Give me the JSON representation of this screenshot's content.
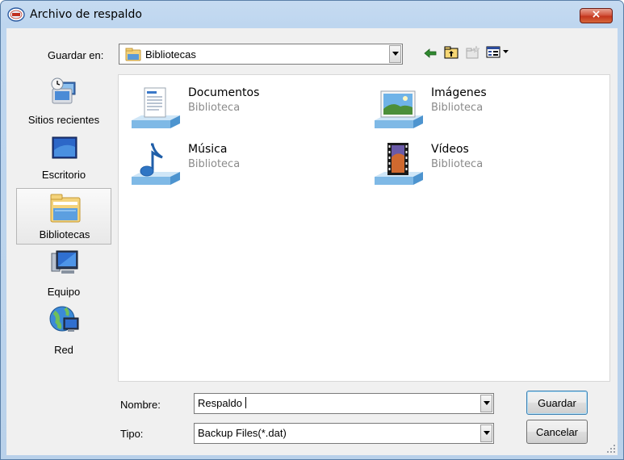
{
  "window": {
    "title": "Archivo de respaldo",
    "close_label": "×"
  },
  "toolbar": {
    "save_in_label": "Guardar en:",
    "location_value": "Bibliotecas",
    "icons": [
      "back-arrow-icon",
      "up-folder-icon",
      "new-folder-icon",
      "view-menu-icon"
    ]
  },
  "places": [
    {
      "label": "Sitios recientes",
      "icon": "recent-places-icon"
    },
    {
      "label": "Escritorio",
      "icon": "desktop-icon"
    },
    {
      "label": "Bibliotecas",
      "icon": "libraries-icon",
      "selected": true
    },
    {
      "label": "Equipo",
      "icon": "computer-icon"
    },
    {
      "label": "Red",
      "icon": "network-icon"
    }
  ],
  "libraries": [
    {
      "name": "Documentos",
      "type": "Biblioteca",
      "icon": "documents-library-icon"
    },
    {
      "name": "Imágenes",
      "type": "Biblioteca",
      "icon": "pictures-library-icon"
    },
    {
      "name": "Música",
      "type": "Biblioteca",
      "icon": "music-library-icon"
    },
    {
      "name": "Vídeos",
      "type": "Biblioteca",
      "icon": "videos-library-icon"
    }
  ],
  "form": {
    "name_label": "Nombre:",
    "name_value": "Respaldo",
    "type_label": "Tipo:",
    "type_value": "Backup Files(*.dat)"
  },
  "buttons": {
    "save_label": "Guardar",
    "cancel_label": "Cancelar"
  },
  "colors": {
    "title_bar": "#bed6ef",
    "close_button": "#c4361e",
    "dialog_background": "#f0f0f0",
    "secondary_text": "#8a8a8a"
  }
}
